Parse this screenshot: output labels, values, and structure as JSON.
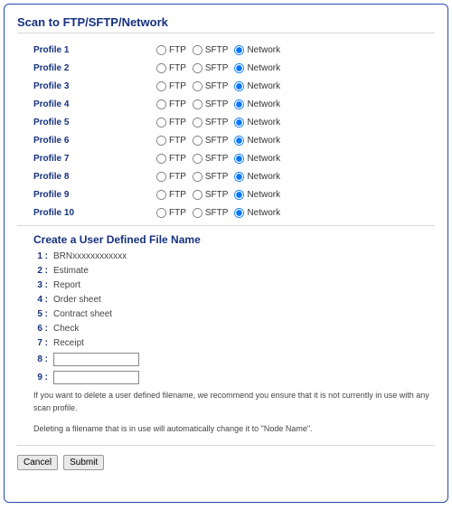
{
  "title": "Scan to FTP/SFTP/Network",
  "radio_labels": {
    "ftp": "FTP",
    "sftp": "SFTP",
    "network": "Network"
  },
  "profiles": [
    {
      "label": "Profile 1",
      "selected": "network"
    },
    {
      "label": "Profile 2",
      "selected": "network"
    },
    {
      "label": "Profile 3",
      "selected": "network"
    },
    {
      "label": "Profile 4",
      "selected": "network"
    },
    {
      "label": "Profile 5",
      "selected": "network"
    },
    {
      "label": "Profile 6",
      "selected": "network"
    },
    {
      "label": "Profile 7",
      "selected": "network"
    },
    {
      "label": "Profile 8",
      "selected": "network"
    },
    {
      "label": "Profile 9",
      "selected": "network"
    },
    {
      "label": "Profile 10",
      "selected": "network"
    }
  ],
  "filename_section_title": "Create a User Defined File Name",
  "filenames": [
    {
      "idx": "1 :",
      "value": "BRNxxxxxxxxxxxx",
      "editable": false
    },
    {
      "idx": "2 :",
      "value": "Estimate",
      "editable": false
    },
    {
      "idx": "3 :",
      "value": "Report",
      "editable": false
    },
    {
      "idx": "4 :",
      "value": "Order sheet",
      "editable": false
    },
    {
      "idx": "5 :",
      "value": "Contract sheet",
      "editable": false
    },
    {
      "idx": "6 :",
      "value": "Check",
      "editable": false
    },
    {
      "idx": "7 :",
      "value": "Receipt",
      "editable": false
    },
    {
      "idx": "8 :",
      "value": "",
      "editable": true
    },
    {
      "idx": "9 :",
      "value": "",
      "editable": true
    }
  ],
  "note1": "If you want to delete a user defined filename, we recommend you ensure that it is not currently in use with any scan profile.",
  "note2": "Deleting a filename that is in use will automatically change it to \"Node Name\".",
  "buttons": {
    "cancel": "Cancel",
    "submit": "Submit"
  }
}
